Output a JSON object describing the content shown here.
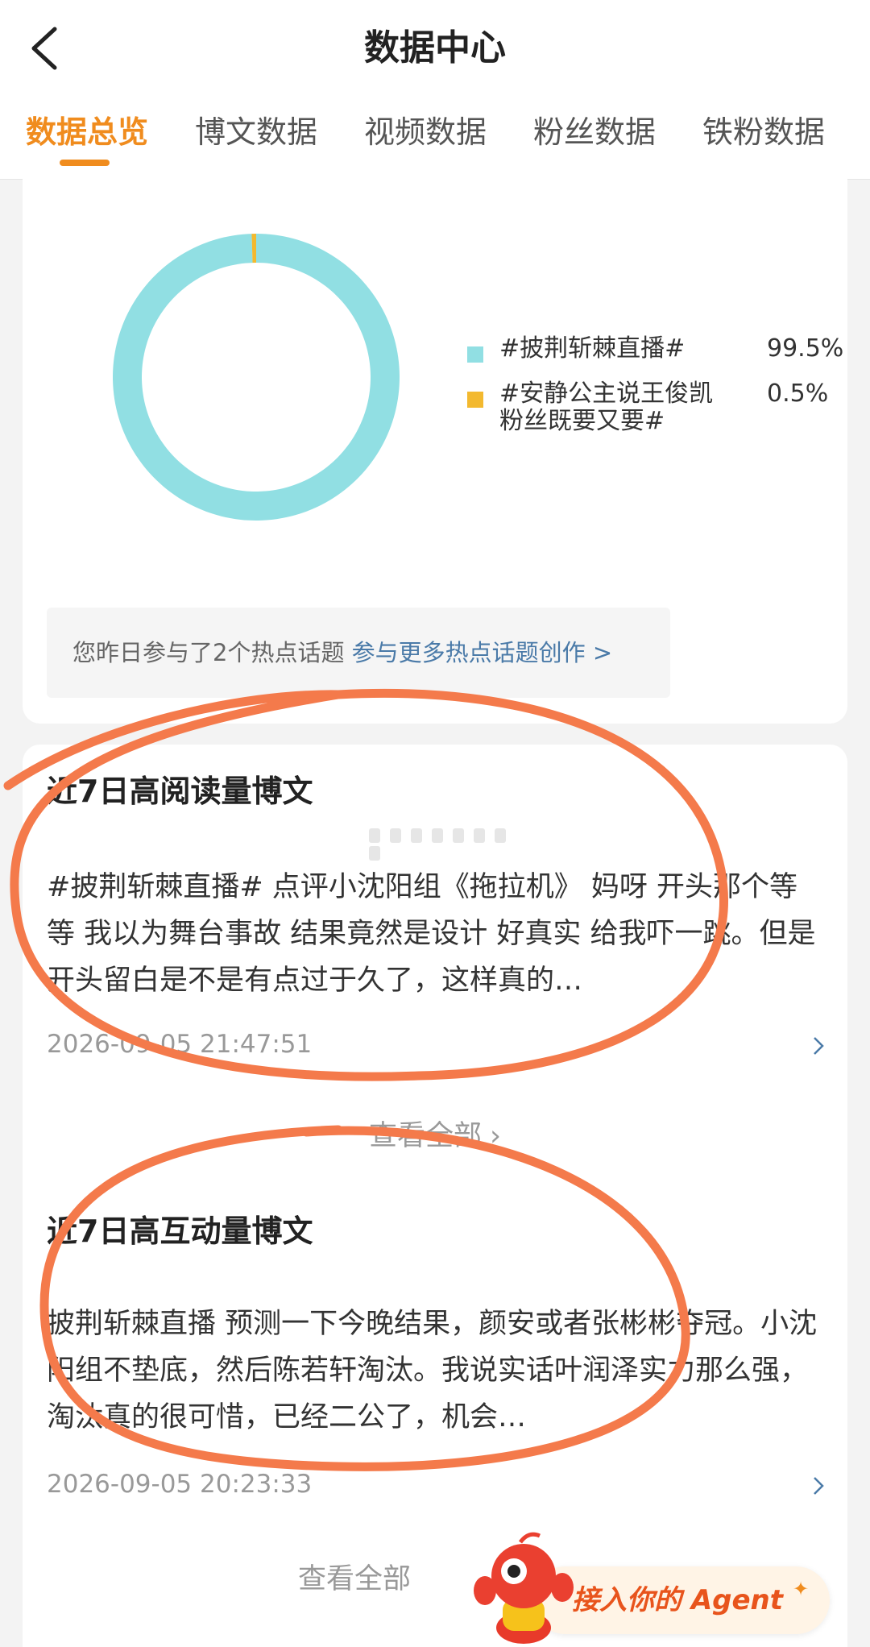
{
  "header": {
    "title": "数据中心",
    "tabs": [
      {
        "label": "数据总览",
        "active": true
      },
      {
        "label": "博文数据",
        "active": false
      },
      {
        "label": "视频数据",
        "active": false
      },
      {
        "label": "粉丝数据",
        "active": false
      },
      {
        "label": "铁粉数据",
        "active": false
      }
    ]
  },
  "topics_chart": {
    "legend": [
      {
        "label": "#披荆斩棘直播#",
        "percent": "99.5%",
        "color": "#91dfe3"
      },
      {
        "label": "#安静公主说王俊凯粉丝既要又要#",
        "percent": "0.5%",
        "color": "#f3b92f"
      }
    ],
    "hint_text": "您昨日参与了2个热点话题",
    "hint_link": "参与更多热点话题创作 >"
  },
  "chart_data": {
    "type": "pie",
    "categories": [
      "#披荆斩棘直播#",
      "#安静公主说王俊凯粉丝既要又要#"
    ],
    "values": [
      99.5,
      0.5
    ],
    "colors": [
      "#91dfe3",
      "#f3b92f"
    ]
  },
  "top_read": {
    "title": "近7日高阅读量博文",
    "post_text": "#披荆斩棘直播# 点评小沈阳组《拖拉机》 妈呀 开头那个等等 我以为舞台事故 结果竟然是设计 好真实 给我吓一跳。但是开头留白是不是有点过于久了，这样真的…",
    "time": "2026-09-05 21:47:51",
    "view_all": "查看全部"
  },
  "top_interact": {
    "title": "近7日高互动量博文",
    "post_text": "披荆斩棘直播 预测一下今晚结果，颜安或者张彬彬夺冠。小沈阳组不垫底，然后陈若轩淘汰。我说实话叶润泽实力那么强，淘汰真的很可惜，已经二公了，机会…",
    "time": "2026-09-05 20:23:33",
    "view_all": "查看全部"
  },
  "agent_button": {
    "label": "接入你的 Agent"
  },
  "accent_color": "#f08c1e",
  "annotation_color": "#f47a4b"
}
